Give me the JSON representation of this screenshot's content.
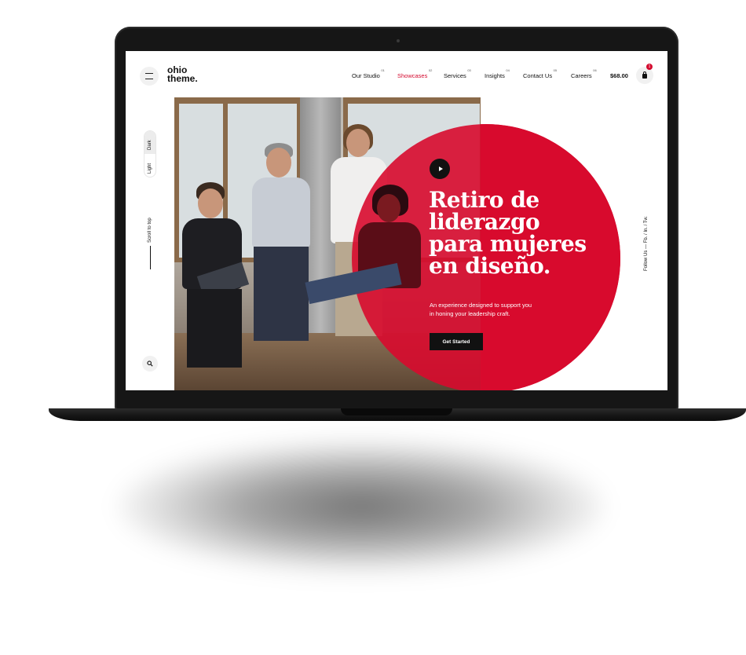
{
  "brand": {
    "line1": "ohio",
    "line2": "theme."
  },
  "nav": {
    "items": [
      {
        "num": "01",
        "label": "Our Studio"
      },
      {
        "num": "02",
        "label": "Showcases"
      },
      {
        "num": "03",
        "label": "Services"
      },
      {
        "num": "04",
        "label": "Insights"
      },
      {
        "num": "05",
        "label": "Contact Us"
      },
      {
        "num": "06",
        "label": "Careers"
      }
    ],
    "active": "Showcases"
  },
  "cart": {
    "price": "$68.00",
    "count": "1"
  },
  "sidebar": {
    "theme_dark": "Dark",
    "theme_light": "Light",
    "scroll_to_top": "Scroll to top"
  },
  "hero": {
    "title_lines": [
      "Retiro de",
      "liderazgo",
      "para mujeres",
      "en diseño."
    ],
    "subtitle_lines": [
      "An experience designed to support you",
      "in honing your leadership craft."
    ],
    "cta": "Get Started"
  },
  "social": {
    "text": "Follow Us — Fb. / In. / Tw."
  },
  "colors": {
    "accent": "#d80a2d",
    "dark": "#111111",
    "laptop": "#161616"
  },
  "icons": [
    "menu-icon",
    "cart-icon",
    "search-icon",
    "play-icon"
  ]
}
